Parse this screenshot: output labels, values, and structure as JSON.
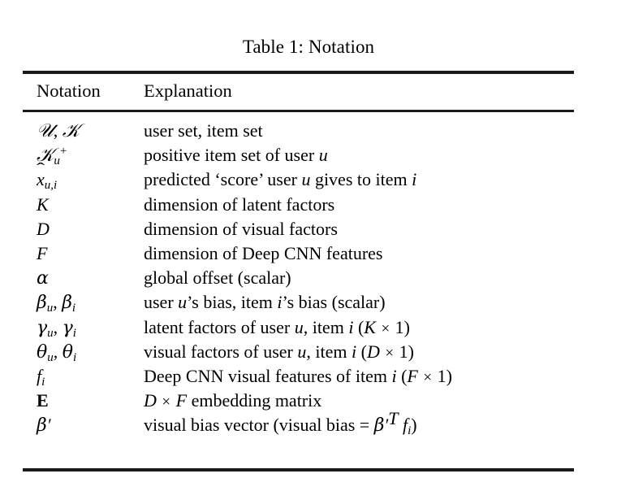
{
  "document": {
    "caption": "Table 1: Notation",
    "headers": {
      "notation": "Notation",
      "explanation": "Explanation"
    },
    "rows": [
      {
        "notation_text": "U, I",
        "explanation_text": "user set, item set"
      },
      {
        "notation_text": "I_u^+",
        "explanation_text": "positive item set of user u"
      },
      {
        "notation_text": "x̂_u,i",
        "explanation_text": "predicted ‘score’ user u gives to item i"
      },
      {
        "notation_text": "K",
        "explanation_text": "dimension of latent factors"
      },
      {
        "notation_text": "D",
        "explanation_text": "dimension of visual factors"
      },
      {
        "notation_text": "F",
        "explanation_text": "dimension of Deep CNN features"
      },
      {
        "notation_text": "α",
        "explanation_text": "global offset (scalar)"
      },
      {
        "notation_text": "β_u, β_i",
        "explanation_text": "user u’s bias, item i’s bias (scalar)"
      },
      {
        "notation_text": "γ_u, γ_i",
        "explanation_text": "latent factors of user u, item i (K × 1)"
      },
      {
        "notation_text": "θ_u, θ_i",
        "explanation_text": "visual factors of user u, item i (D × 1)"
      },
      {
        "notation_text": "f_i",
        "explanation_text": "Deep CNN visual features of item i (F × 1)"
      },
      {
        "notation_text": "E",
        "explanation_text": "D × F embedding matrix"
      },
      {
        "notation_text": "β′",
        "explanation_text": "visual bias vector (visual bias = β′ᵀ f_i)"
      }
    ]
  },
  "colors": {
    "page_background": "#ffffff",
    "text": "#000000",
    "rule": "#1a1a1a"
  }
}
